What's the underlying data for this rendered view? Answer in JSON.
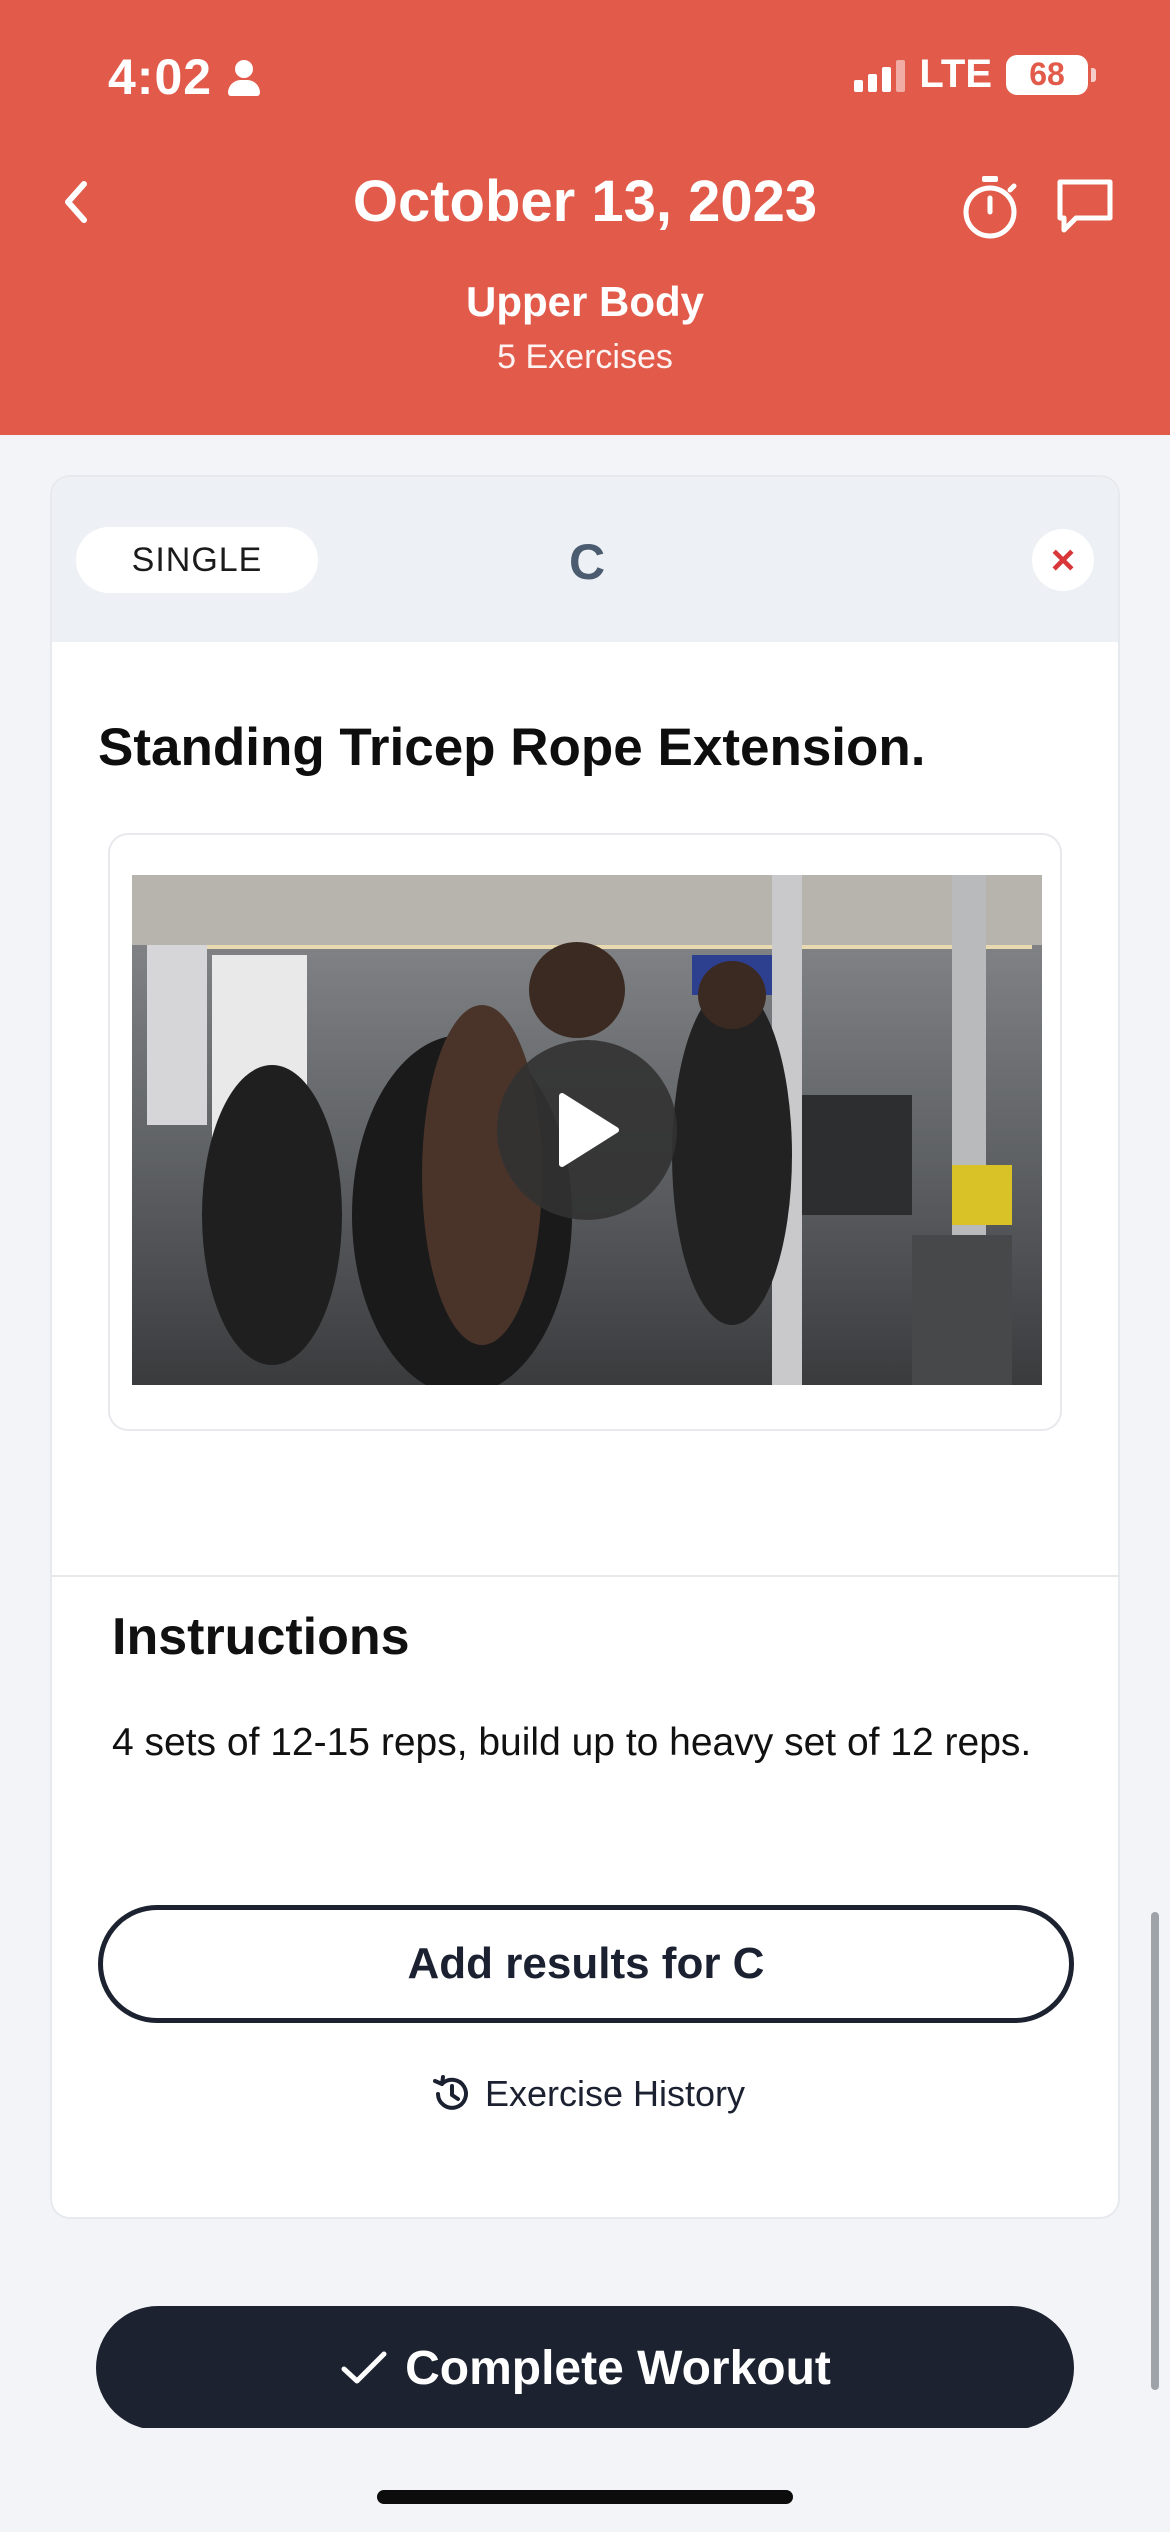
{
  "status_bar": {
    "time": "4:02",
    "network": "LTE",
    "battery": "68"
  },
  "header": {
    "title": "October 13, 2023",
    "subtitle": "Upper Body",
    "exercise_count": "5 Exercises",
    "background_color": "#e25b4a"
  },
  "card": {
    "type_label": "SINGLE",
    "block_letter": "C",
    "close_label": "×",
    "exercise_name": "Standing Tricep Rope Extension.",
    "video": {
      "play_icon": "play-icon"
    },
    "instructions_title": "Instructions",
    "instructions_text": "4 sets of 12-15 reps, build up to heavy set of 12 reps.",
    "add_results_label": "Add results for C",
    "history_label": "Exercise History"
  },
  "footer": {
    "complete_label": "Complete Workout",
    "button_color": "#1c2230"
  }
}
